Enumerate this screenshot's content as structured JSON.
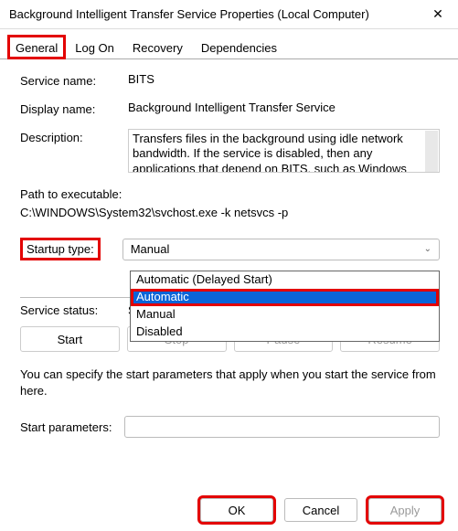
{
  "window": {
    "title": "Background Intelligent Transfer Service Properties (Local Computer)"
  },
  "tabs": {
    "general": "General",
    "logon": "Log On",
    "recovery": "Recovery",
    "dependencies": "Dependencies"
  },
  "labels": {
    "service_name": "Service name:",
    "display_name": "Display name:",
    "description": "Description:",
    "path_label": "Path to executable:",
    "startup_type": "Startup type:",
    "service_status": "Service status:",
    "start_params": "Start parameters:"
  },
  "values": {
    "service_name": "BITS",
    "display_name": "Background Intelligent Transfer Service",
    "description": "Transfers files in the background using idle network bandwidth. If the service is disabled, then any applications that depend on BITS, such as Windows",
    "path": "C:\\WINDOWS\\System32\\svchost.exe -k netsvcs -p",
    "startup_selected": "Manual",
    "service_status": "Stopped",
    "start_params": ""
  },
  "startup_options": {
    "o0": "Automatic (Delayed Start)",
    "o1": "Automatic",
    "o2": "Manual",
    "o3": "Disabled"
  },
  "buttons": {
    "start": "Start",
    "stop": "Stop",
    "pause": "Pause",
    "resume": "Resume",
    "ok": "OK",
    "cancel": "Cancel",
    "apply": "Apply"
  },
  "note": "You can specify the start parameters that apply when you start the service from here."
}
